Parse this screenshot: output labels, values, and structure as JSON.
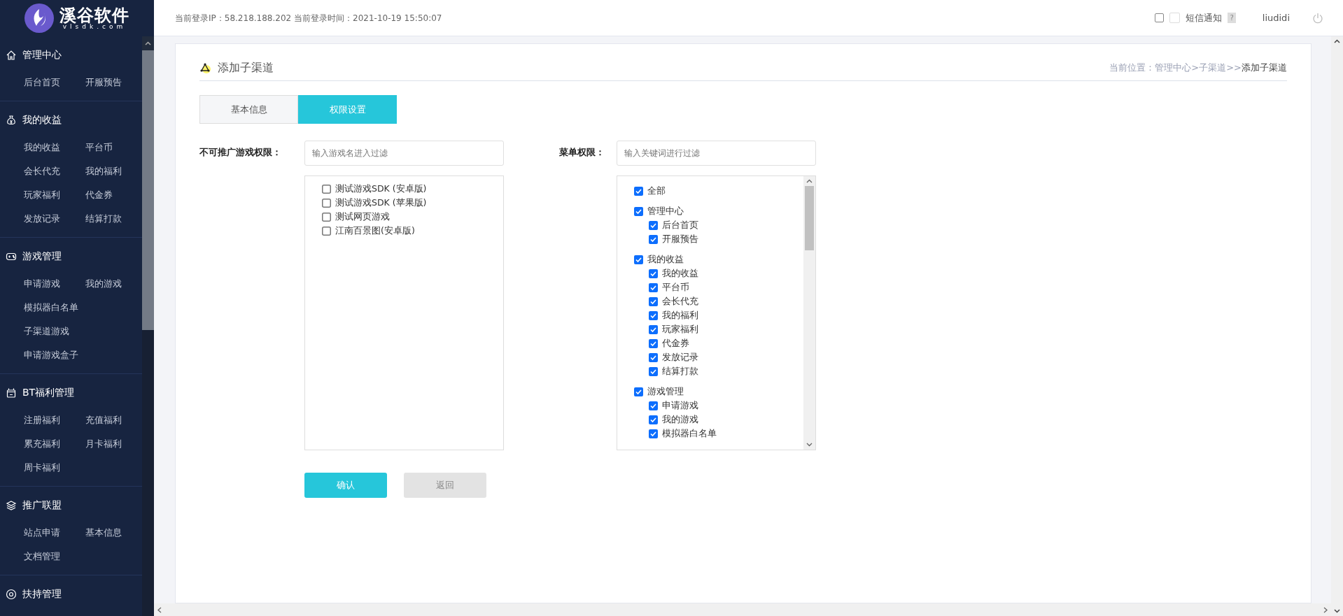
{
  "logo": {
    "name": "溪谷软件",
    "domain": "vlsdk.com"
  },
  "sidebar": {
    "groups": [
      {
        "title": "管理中心",
        "items": [
          "后台首页",
          "开服预告"
        ]
      },
      {
        "title": "我的收益",
        "items": [
          "我的收益",
          "平台币",
          "会长代充",
          "我的福利",
          "玩家福利",
          "代金券",
          "发放记录",
          "结算打款"
        ]
      },
      {
        "title": "游戏管理",
        "items": [
          "申请游戏",
          "我的游戏",
          "模拟器白名单",
          "子渠道游戏",
          "申请游戏盒子"
        ]
      },
      {
        "title": "BT福利管理",
        "items": [
          "注册福利",
          "充值福利",
          "累充福利",
          "月卡福利",
          "周卡福利"
        ]
      },
      {
        "title": "推广联盟",
        "items": [
          "站点申请",
          "基本信息",
          "文档管理"
        ]
      },
      {
        "title": "扶持管理"
      }
    ]
  },
  "topbar": {
    "login_info": "当前登录IP：58.218.188.202 当前登录时间：2021-10-19 15:50:07",
    "sms": {
      "label": "短信通知",
      "checked": false,
      "help": "?"
    },
    "user": "liudidi"
  },
  "page": {
    "title": "添加子渠道",
    "breadcrumb": {
      "prefix": "当前位置：管理中心>子渠道>>",
      "current": "添加子渠道"
    }
  },
  "tabs": [
    {
      "label": "基本信息",
      "selected": false
    },
    {
      "label": "权限设置",
      "selected": true
    }
  ],
  "game_filter": {
    "label": "不可推广游戏权限：",
    "placeholder": "输入游戏名进入过滤",
    "games": [
      {
        "label": "测试游戏SDK (安卓版)",
        "checked": false
      },
      {
        "label": "测试游戏SDK (苹果版)",
        "checked": false
      },
      {
        "label": "测试网页游戏",
        "checked": false
      },
      {
        "label": "江南百景图(安卓版)",
        "checked": false
      }
    ]
  },
  "menu_filter": {
    "label": "菜单权限：",
    "placeholder": "输入关键词进行过滤",
    "tree": [
      {
        "label": "全部",
        "checked": true
      },
      {
        "label": "管理中心",
        "checked": true,
        "children": [
          {
            "label": "后台首页",
            "checked": true
          },
          {
            "label": "开服预告",
            "checked": true
          }
        ]
      },
      {
        "label": "我的收益",
        "checked": true,
        "children": [
          {
            "label": "我的收益",
            "checked": true
          },
          {
            "label": "平台币",
            "checked": true
          },
          {
            "label": "会长代充",
            "checked": true
          },
          {
            "label": "我的福利",
            "checked": true
          },
          {
            "label": "玩家福利",
            "checked": true
          },
          {
            "label": "代金券",
            "checked": true
          },
          {
            "label": "发放记录",
            "checked": true
          },
          {
            "label": "结算打款",
            "checked": true
          }
        ]
      },
      {
        "label": "游戏管理",
        "checked": true,
        "children": [
          {
            "label": "申请游戏",
            "checked": true
          },
          {
            "label": "我的游戏",
            "checked": true
          },
          {
            "label": "模拟器白名单",
            "checked": true
          }
        ]
      }
    ]
  },
  "buttons": [
    {
      "label": "确认",
      "kind": "primary"
    },
    {
      "label": "返回",
      "kind": "secondary"
    }
  ]
}
